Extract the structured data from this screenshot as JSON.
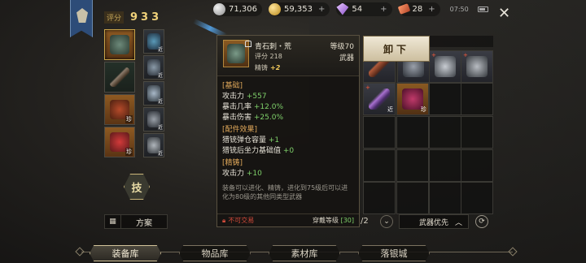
{
  "currency": [
    {
      "icon": "silver-coin-icon",
      "value": "71,306",
      "plus": ""
    },
    {
      "icon": "gold-coin-icon",
      "value": "59,353",
      "plus": "+"
    },
    {
      "icon": "purple-gem-icon",
      "value": "54",
      "plus": "+"
    },
    {
      "icon": "ticket-icon",
      "value": "28",
      "plus": "+"
    }
  ],
  "status": {
    "time": "07:50"
  },
  "close_label": "✕",
  "score": {
    "label": "评分",
    "value": "933"
  },
  "equip_tags": {
    "t1": "近",
    "t2": "近",
    "t3": "近",
    "t4": "近",
    "t5": "珍",
    "t6": "珍",
    "t7": "近"
  },
  "skill_label": "技",
  "plan": {
    "icon": "▦",
    "label": "方案"
  },
  "tooltip": {
    "name": "青石刺・荒",
    "level": "等级70",
    "score": "评分 218",
    "type": "武器",
    "refine_label": "精铸",
    "refine_value": "+2",
    "sections": {
      "basic": "[基础]",
      "basic_attack": "攻击力",
      "basic_attack_val": "+557",
      "crit_rate": "暴击几率",
      "crit_rate_val": "+12.0%",
      "crit_dmg": "暴击伤害",
      "crit_dmg_val": "+25.0%",
      "parts": "[配件效果]",
      "mag": "猎铳弹仓容量",
      "mag_val": "+1",
      "recoil": "猎铳后坐力基础值",
      "recoil_val": "+0",
      "refine": "[精铸]",
      "refine_attack": "攻击力",
      "refine_attack_val": "+10"
    },
    "description": "装备可以进化、精铸，进化到75级后可以进化为80级的其他同类型武器",
    "no_trade": "不可交易",
    "req_label": "穿戴等级",
    "req_value": "[30]"
  },
  "unequip_label": "卸下",
  "inventory": {
    "tags": {
      "i1": "珍",
      "i2": "近",
      "i3": "近",
      "i4": "近",
      "i5": "珍"
    },
    "red": {
      "r1": "+",
      "r2": "+",
      "r3": "+"
    },
    "page": "/2",
    "sort_label": "武器优先"
  },
  "tabs": [
    {
      "label": "装备库",
      "active": true
    },
    {
      "label": "物品库",
      "active": false
    },
    {
      "label": "素材库",
      "active": false
    },
    {
      "label": "落银城",
      "active": false
    }
  ]
}
